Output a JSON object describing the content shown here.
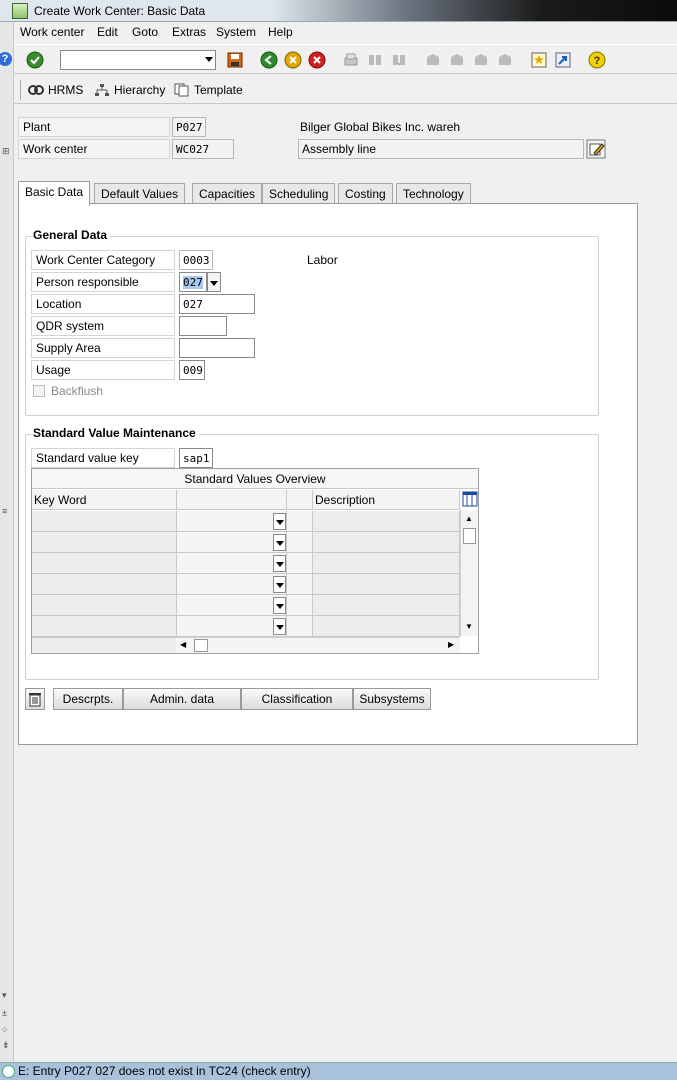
{
  "window": {
    "title": "Create Work Center: Basic Data"
  },
  "menu": [
    "Work center",
    "Edit",
    "Goto",
    "Extras",
    "System",
    "Help"
  ],
  "app_toolbar": {
    "hrms": "HRMS",
    "hierarchy": "Hierarchy",
    "template": "Template"
  },
  "header": {
    "plant_label": "Plant",
    "plant_value": "P027",
    "plant_desc": "Bilger Global Bikes Inc. wareh",
    "workcenter_label": "Work center",
    "workcenter_value": "WC027",
    "workcenter_desc": "Assembly line"
  },
  "tabs": [
    "Basic Data",
    "Default Values",
    "Capacities",
    "Scheduling",
    "Costing",
    "Technology"
  ],
  "general_data": {
    "title": "General Data",
    "category_label": "Work Center Category",
    "category_value": "0003",
    "category_desc": "Labor",
    "person_label": "Person responsible",
    "person_value": "027",
    "location_label": "Location",
    "location_value": "027",
    "qdr_label": "QDR system",
    "qdr_value": "",
    "supply_label": "Supply Area",
    "supply_value": "",
    "usage_label": "Usage",
    "usage_value": "009",
    "backflush_label": "Backflush"
  },
  "std_values": {
    "title": "Standard Value Maintenance",
    "key_label": "Standard value key",
    "key_value": "sap1",
    "overview_title": "Standard Values Overview",
    "col_keyword": "Key Word",
    "col_description": "Description"
  },
  "buttons": {
    "descrpts": "Descrpts.",
    "admin": "Admin. data",
    "classification": "Classification",
    "subsystems": "Subsystems"
  },
  "status": {
    "message": "E: Entry P027 027  does not exist in TC24 (check entry)"
  }
}
